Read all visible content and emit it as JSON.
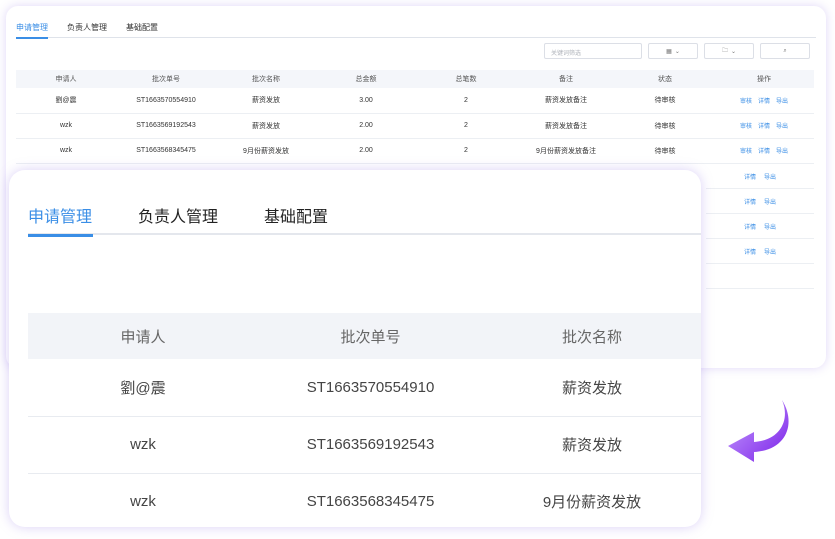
{
  "tabs": [
    {
      "label": "申请管理",
      "active": true
    },
    {
      "label": "负责人管理",
      "active": false
    },
    {
      "label": "基础配置",
      "active": false
    }
  ],
  "toolbar": {
    "search_placeholder": "关键词筛选",
    "view_icon": "grid-icon",
    "folder_icon": "folder-icon",
    "search_icon": "search-icon"
  },
  "columns": [
    "申请人",
    "批次单号",
    "批次名称",
    "总金额",
    "总笔数",
    "备注",
    "状态",
    "操作"
  ],
  "rows": [
    {
      "applicant": "劉@震",
      "batch_no": "ST1663570554910",
      "batch_name": "薪资发放",
      "amount": "3.00",
      "count": "2",
      "note": "薪资发放备注",
      "status": "待审核",
      "ops": [
        "审核",
        "详情",
        "导出"
      ]
    },
    {
      "applicant": "wzk",
      "batch_no": "ST1663569192543",
      "batch_name": "薪资发放",
      "amount": "2.00",
      "count": "2",
      "note": "薪资发放备注",
      "status": "待审核",
      "ops": [
        "审核",
        "详情",
        "导出"
      ]
    },
    {
      "applicant": "wzk",
      "batch_no": "ST1663568345475",
      "batch_name": "9月份薪资发放",
      "amount": "2.00",
      "count": "2",
      "note": "9月份薪资发放备注",
      "status": "待审核",
      "ops": [
        "审核",
        "详情",
        "导出"
      ]
    }
  ],
  "extra_rows_ops": [
    [
      "详情",
      "导出"
    ],
    [
      "详情",
      "导出"
    ],
    [
      "详情",
      "导出"
    ],
    [
      "详情",
      "导出"
    ]
  ],
  "colors": {
    "accent": "#3a8ee6",
    "arrow": "#8b2ff0"
  }
}
